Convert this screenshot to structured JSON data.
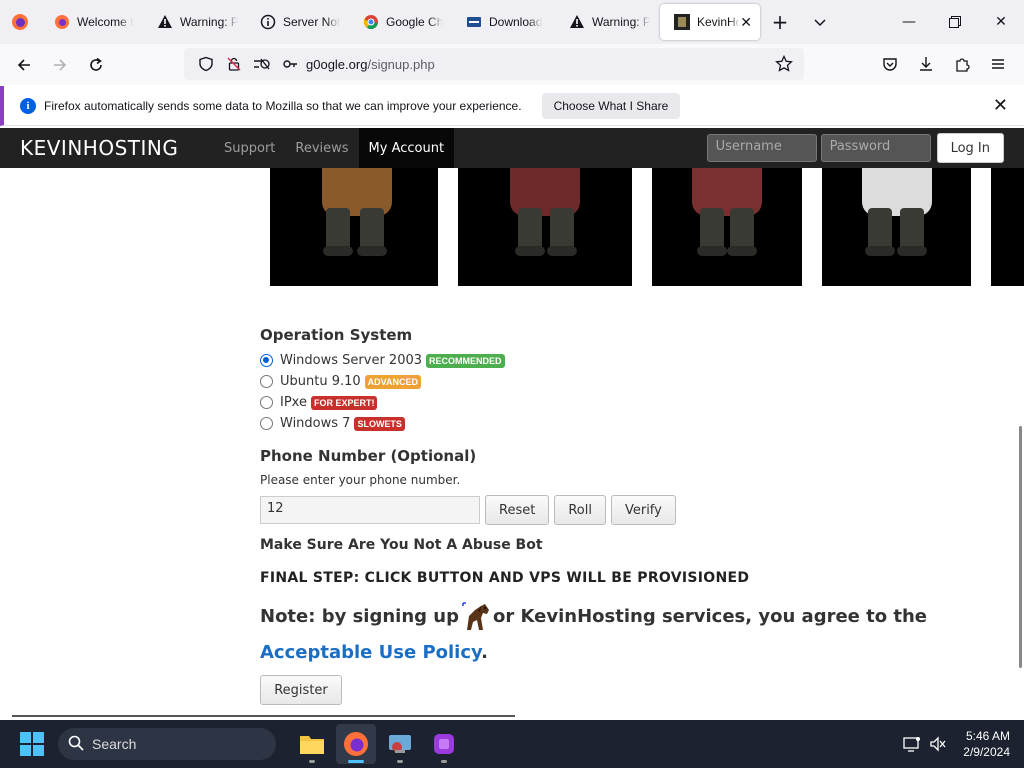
{
  "browser": {
    "tabs": [
      {
        "title": "Welcome t",
        "icon": "firefox-icon"
      },
      {
        "title": "Warning: P",
        "icon": "warning-icon"
      },
      {
        "title": "Server Not",
        "icon": "info-icon"
      },
      {
        "title": "Google Ch",
        "icon": "chrome-icon"
      },
      {
        "title": "Download",
        "icon": "vmware-icon"
      },
      {
        "title": "Warning: P",
        "icon": "warning-icon"
      },
      {
        "title": "KevinHo",
        "icon": "site-icon",
        "active": true
      }
    ],
    "url": "g0ogle.org",
    "url_path": "/signup.php"
  },
  "notification": {
    "message": "Firefox automatically sends some data to Mozilla so that we can improve your experience.",
    "button": "Choose What I Share"
  },
  "site": {
    "brand": "KEVINHOSTING",
    "nav": [
      "Support",
      "Reviews",
      "My Account"
    ],
    "username_placeholder": "Username",
    "password_placeholder": "Password",
    "login_button": "Log In"
  },
  "form": {
    "os_heading": "Operation System",
    "os_options": [
      {
        "label": "Windows Server 2003",
        "badge": "RECOMMENDED",
        "badge_color": "#4cae4c",
        "checked": true
      },
      {
        "label": "Ubuntu 9.10",
        "badge": "ADVANCED",
        "badge_color": "#eea236",
        "checked": false
      },
      {
        "label": "IPxe",
        "badge": "FOR EXPERT!",
        "badge_color": "#c9302c",
        "checked": false
      },
      {
        "label": "Windows 7",
        "badge": "SLOWETS",
        "badge_color": "#c9302c",
        "checked": false
      }
    ],
    "phone_heading": "Phone Number (Optional)",
    "phone_hint": "Please enter your phone number.",
    "phone_value": "12",
    "buttons": [
      "Reset",
      "Roll",
      "Verify"
    ],
    "abuse_text": "Make Sure Are You Not A Abuse Bot",
    "final_step": "FINAL STEP: CLICK BUTTON AND VPS WILL BE PROVISIONED",
    "note_start": "Note: by signing up",
    "note_mid": "or KevinHosting services, you agree to the",
    "note_link": "Acceptable Use Policy",
    "note_end": ".",
    "register": "Register"
  },
  "taskbar": {
    "search": "Search",
    "time": "5:46 AM",
    "date": "2/9/2024"
  }
}
